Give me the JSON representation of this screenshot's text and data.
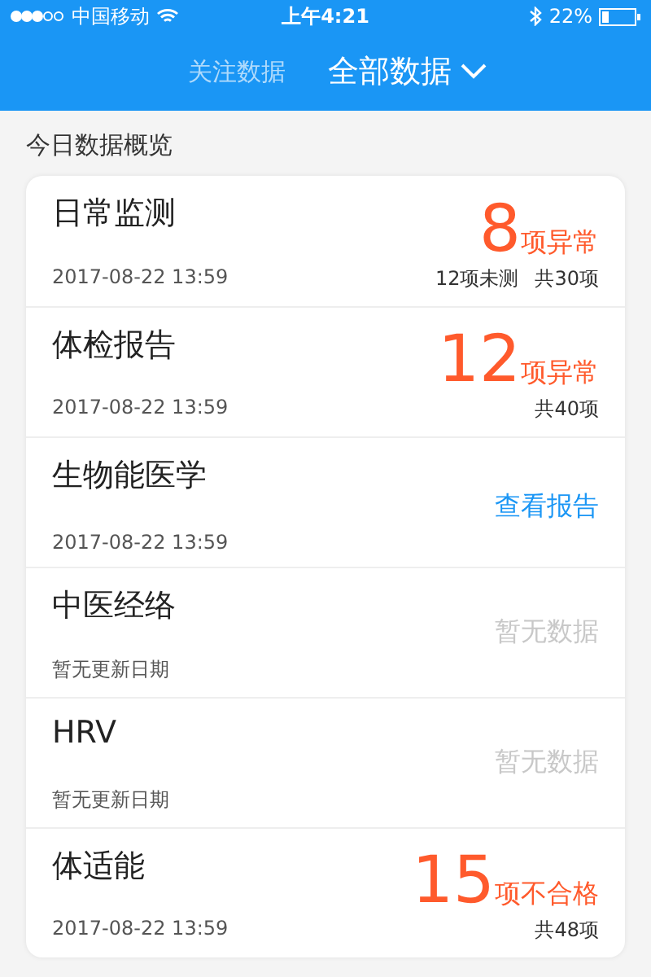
{
  "status_bar": {
    "carrier": "中国移动",
    "time": "上午4:21",
    "battery": "22%"
  },
  "tabs": [
    {
      "label": "关注数据",
      "selected": false
    },
    {
      "label": "全部数据",
      "selected": true
    }
  ],
  "section_title": "今日数据概览",
  "items": [
    {
      "kind": "abnormal",
      "title": "日常监测",
      "count": "8",
      "status": "项异常",
      "date": "2017-08-22 13:59",
      "notes": [
        "12项未测",
        "共30项"
      ]
    },
    {
      "kind": "abnormal",
      "title": "体检报告",
      "count": "12",
      "status": "项异常",
      "date": "2017-08-22 13:59",
      "notes": [
        "共40项"
      ]
    },
    {
      "kind": "link",
      "title": "生物能医学",
      "status": "查看报告",
      "date": "2017-08-22 13:59"
    },
    {
      "kind": "nodata",
      "title": "中医经络",
      "status": "暂无数据",
      "date": "暂无更新日期"
    },
    {
      "kind": "nodata",
      "title": "HRV",
      "status": "暂无数据",
      "date": "暂无更新日期"
    },
    {
      "kind": "abnormal",
      "title": "体适能",
      "count": "15",
      "status": "项不合格",
      "date": "2017-08-22 13:59",
      "notes": [
        "共48项"
      ]
    }
  ]
}
